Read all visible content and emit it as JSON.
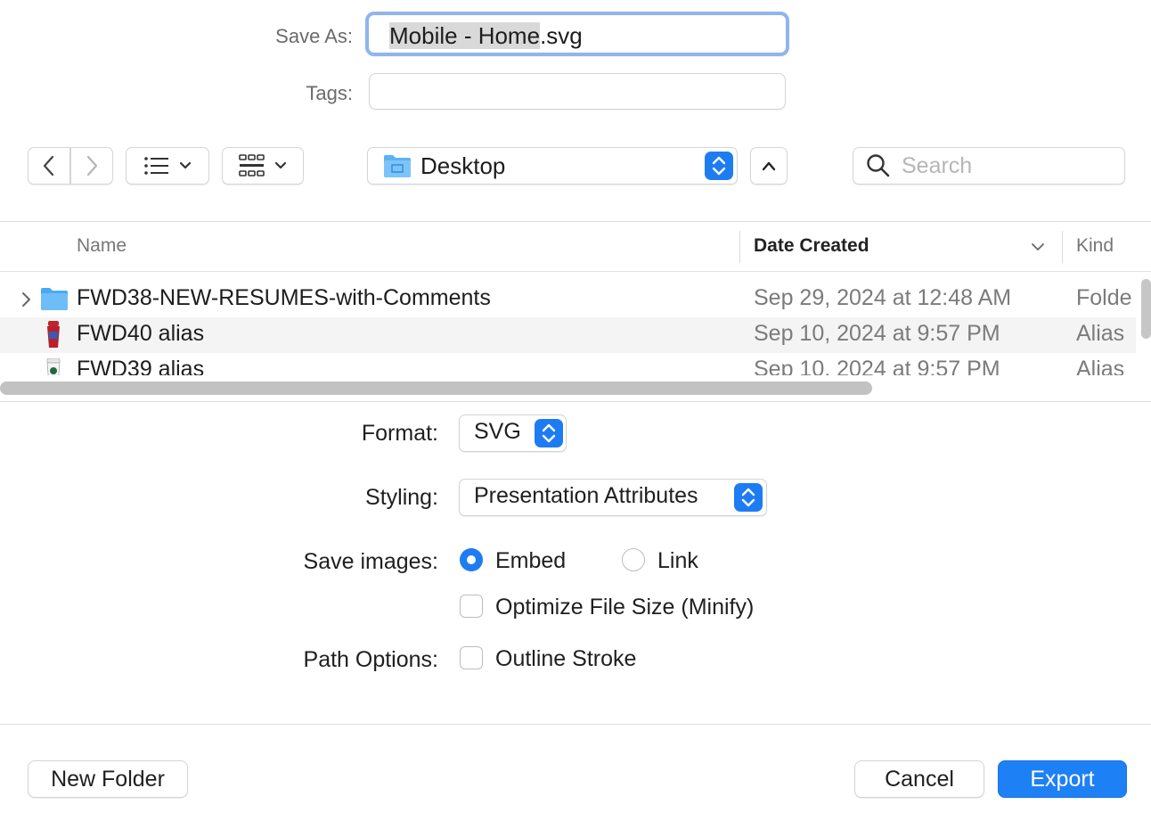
{
  "save_as": {
    "label": "Save As:",
    "value_selected": "Mobile - Home",
    "value_ext": ".svg"
  },
  "tags": {
    "label": "Tags:",
    "value": ""
  },
  "toolbar": {
    "location": "Desktop",
    "search_placeholder": "Search"
  },
  "columns": {
    "name": "Name",
    "date_created": "Date Created",
    "kind": "Kind"
  },
  "files": [
    {
      "name": "FWD38-NEW-RESUMES-with-Comments",
      "date": "Sep 29, 2024 at 12:48 AM",
      "kind": "Folde",
      "icon": "folder-icon"
    },
    {
      "name": "FWD40 alias",
      "date": "Sep 10, 2024 at 9:57 PM",
      "kind": "Alias",
      "icon": "alias-cup-icon"
    },
    {
      "name": "FWD39 alias",
      "date": "Sep 10, 2024 at 9:57 PM",
      "kind": "Alias",
      "icon": "alias-starbucks-icon"
    }
  ],
  "options": {
    "format_label": "Format:",
    "format_value": "SVG",
    "styling_label": "Styling:",
    "styling_value": "Presentation Attributes",
    "save_images_label": "Save images:",
    "embed_label": "Embed",
    "embed_selected": true,
    "link_label": "Link",
    "optimize_label": "Optimize File Size (Minify)",
    "optimize_checked": false,
    "path_options_label": "Path Options:",
    "outline_label": "Outline Stroke",
    "outline_checked": false
  },
  "buttons": {
    "new_folder": "New Folder",
    "cancel": "Cancel",
    "export": "Export"
  },
  "colors": {
    "accent": "#1e80f5",
    "focus_ring": "#8fb4ef"
  }
}
